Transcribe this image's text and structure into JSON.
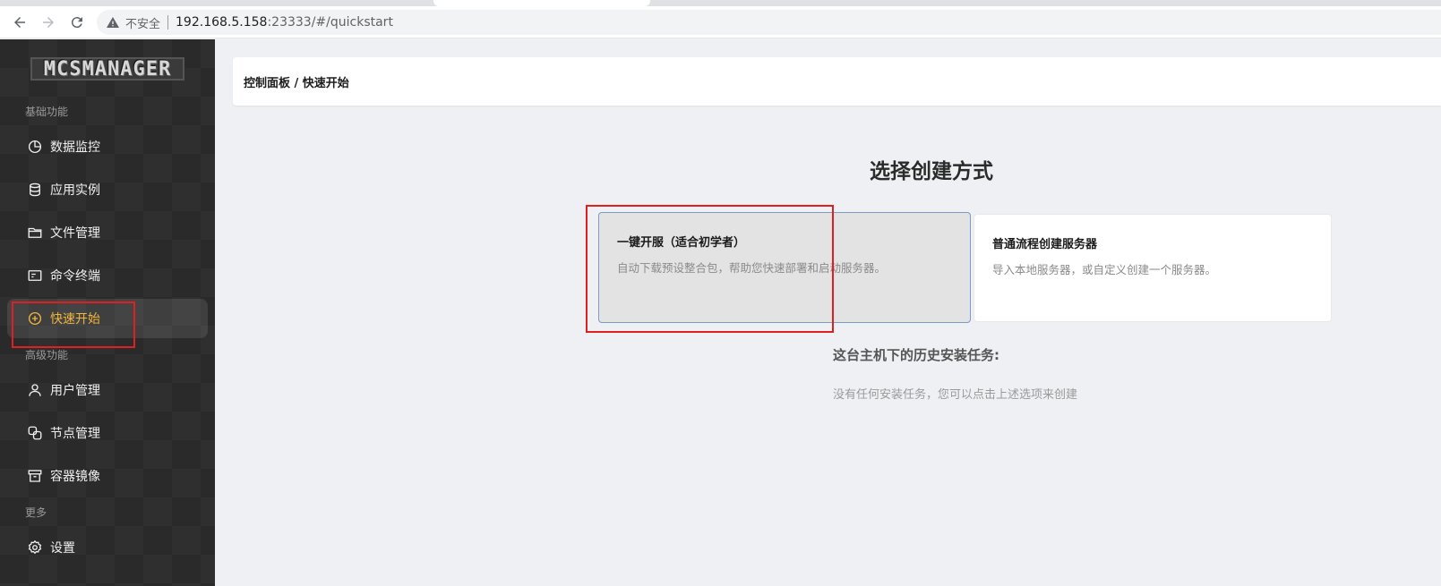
{
  "browser": {
    "security_label": "不安全",
    "url_host": "192.168.5.158",
    "url_rest": ":23333/#/quickstart"
  },
  "sidebar": {
    "logo": "MCSMANAGER",
    "sections": [
      {
        "label": "基础功能"
      },
      {
        "label": "高级功能"
      },
      {
        "label": "更多"
      }
    ],
    "items": [
      {
        "label": "数据监控",
        "icon": "pie-chart-icon"
      },
      {
        "label": "应用实例",
        "icon": "database-icon"
      },
      {
        "label": "文件管理",
        "icon": "folder-icon"
      },
      {
        "label": "命令终端",
        "icon": "terminal-icon"
      },
      {
        "label": "快速开始",
        "icon": "plus-circle-icon",
        "active": true
      },
      {
        "label": "用户管理",
        "icon": "user-icon"
      },
      {
        "label": "节点管理",
        "icon": "nodes-icon"
      },
      {
        "label": "容器镜像",
        "icon": "archive-icon"
      },
      {
        "label": "设置",
        "icon": "gear-icon"
      }
    ],
    "active_color": "#f2b63c"
  },
  "main": {
    "breadcrumb": "控制面板 / 快速开始",
    "heading": "选择创建方式",
    "options": [
      {
        "title": "一键开服（适合初学者）",
        "description": "自动下载预设整合包，帮助您快速部署和启动服务器。"
      },
      {
        "title": "普通流程创建服务器",
        "description": "导入本地服务器，或自定义创建一个服务器。"
      }
    ],
    "history_title": "这台主机下的历史安装任务:",
    "history_empty": "没有任何安装任务，您可以点击上述选项来创建"
  },
  "annotation_color": "#e02020"
}
